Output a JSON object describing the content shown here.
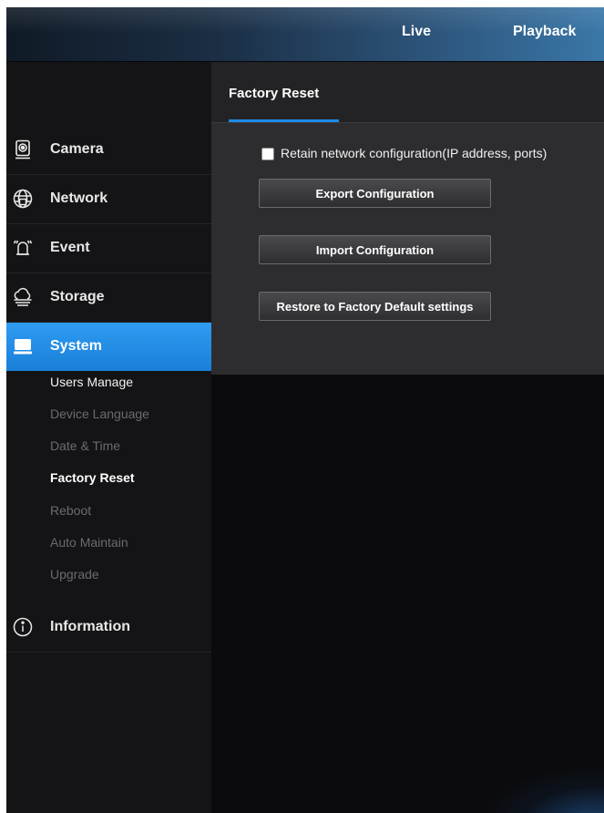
{
  "topnav": {
    "live": "Live",
    "playback": "Playback"
  },
  "sidebar": {
    "items": [
      {
        "label": "Camera",
        "icon": "camera-icon"
      },
      {
        "label": "Network",
        "icon": "network-globe-icon"
      },
      {
        "label": "Event",
        "icon": "alarm-bell-icon"
      },
      {
        "label": "Storage",
        "icon": "cloud-storage-icon"
      },
      {
        "label": "System",
        "icon": "monitor-icon",
        "active": true
      },
      {
        "label": "Information",
        "icon": "info-icon"
      }
    ],
    "system_subitems": [
      {
        "label": "Users Manage"
      },
      {
        "label": "Device Language"
      },
      {
        "label": "Date & Time"
      },
      {
        "label": "Factory Reset",
        "selected": true
      },
      {
        "label": "Reboot"
      },
      {
        "label": "Auto Maintain"
      },
      {
        "label": "Upgrade"
      }
    ]
  },
  "content": {
    "tab_title": "Factory Reset",
    "retain_checkbox": {
      "label": "Retain network configuration(IP address, ports)",
      "checked": false
    },
    "buttons": {
      "export": "Export Configuration",
      "import": "Import Configuration",
      "restore": "Restore to Factory Default settings"
    }
  },
  "colors": {
    "accent": "#1e8ce8",
    "background": "#0b0b0d",
    "panel": "#2d2d30"
  }
}
